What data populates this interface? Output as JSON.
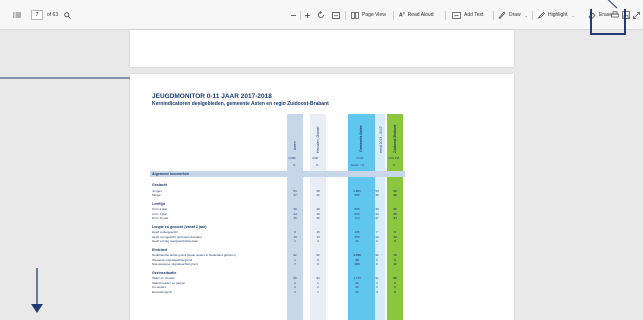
{
  "toolbar": {
    "page_number": "7",
    "page_total": "of 63",
    "page_view": "Page View",
    "read_aloud": "Read Aloud",
    "add_text": "Add Text",
    "draw": "Draw",
    "highlight": "Highlight",
    "erase": "Erase"
  },
  "document": {
    "title": "JEUGDMONITOR 0-11 JAAR 2017-2018",
    "subtitle": "Kernindicatoren deelgebieden, gemeente Asten en regio Zuidoost-Brabant",
    "columns": [
      "Asten",
      "Heusden, Ommel",
      "Gemeente Asten",
      "trend 2013 - 2017",
      "Zuidoost-Brabant"
    ],
    "n_values": [
      "n=326",
      "n=90",
      "n=416",
      "",
      "n=10.946"
    ],
    "pct": [
      "%",
      "%",
      "bemer ↓ %",
      "",
      "%"
    ],
    "sections": [
      {
        "title": "Algemene kenmerken",
        "rows": []
      },
      {
        "title": "Geslacht",
        "rows": [
          {
            "label": "Jongen",
            "v": [
              "53",
              "58",
              "1.880",
              "54",
              "50"
            ]
          },
          {
            "label": "Meisje",
            "v": [
              "47",
              "42",
              "955",
              "46",
              "46"
            ]
          }
        ]
      },
      {
        "title": "Leeftijd",
        "rows": [
          {
            "label": "0 t/m 3 jaar",
            "v": [
              "30",
              "30",
              "565",
              "30",
              "31"
            ]
          },
          {
            "label": "4 t/m 7 jaar",
            "v": [
              "34",
              "35",
              "663",
              "34",
              "35"
            ]
          },
          {
            "label": "8 t/m 11 jaar",
            "v": [
              "36",
              "35",
              "714",
              "37",
              "34"
            ]
          }
        ]
      },
      {
        "title": "Lengte en gewicht (vanaf 2 jaar)",
        "rows": [
          {
            "label": "Heeft ondergewicht",
            "v": [
              "6",
              "15",
              "135",
              "7",
              "6"
            ]
          },
          {
            "label": "Heeft overgewicht (inclusief obesitas)",
            "v": [
              "13",
              "13",
              "255",
              "13",
              "13"
            ]
          },
          {
            "label": "Heeft ernstig overgewicht/obesitas",
            "v": [
              "1",
              "4",
              "31",
              "2",
              "3"
            ]
          }
        ]
      },
      {
        "title": "Etniciteit",
        "rows": [
          {
            "label": "Nederlandse achtergrond (beide ouders in Nederland geboren)",
            "v": [
              "92",
              "92",
              "1.790",
              "92",
              "79"
            ]
          },
          {
            "label": "Westerse migratieachtergrond",
            "v": [
              "1",
              "8",
              "40",
              "6",
              "9"
            ]
          },
          {
            "label": "Niet-westerse migratieachtergrond",
            "v": [
              "7",
              "0",
              "100",
              "6",
              "12"
            ]
          }
        ]
      },
      {
        "title": "Gezinssituatie",
        "rows": [
          {
            "label": "Vader en moeder",
            "v": [
              "86",
              "94",
              "1.770",
              "91",
              "86"
            ]
          },
          {
            "label": "Vader/moeder en partner",
            "v": [
              "2",
              "1",
              "32",
              "2",
              "2"
            ]
          },
          {
            "label": "Co-ouders",
            "v": [
              "2",
              "2",
              "32",
              "3",
              "2"
            ]
          },
          {
            "label": "Eenoudergezin",
            "v": [
              "3",
              "1",
              "60",
              "4",
              "6"
            ]
          }
        ]
      }
    ]
  }
}
